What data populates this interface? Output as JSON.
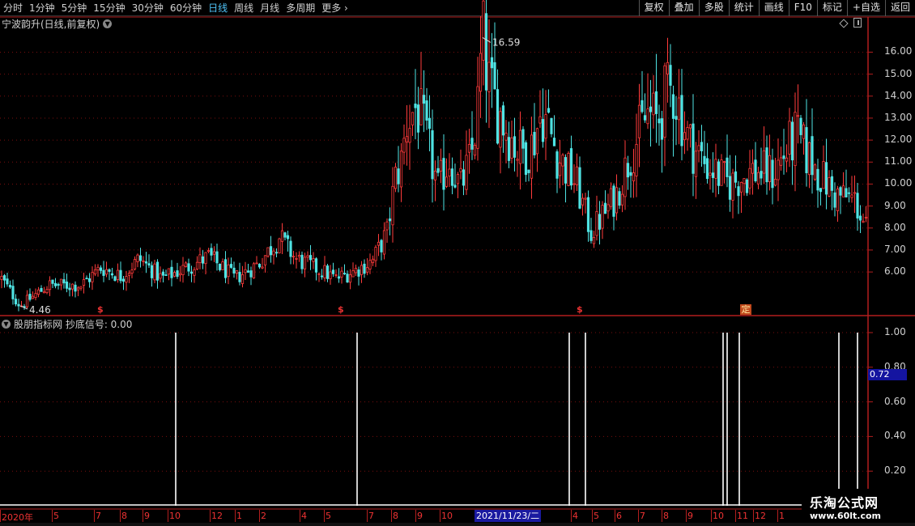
{
  "toolbar": {
    "period_tabs": [
      "分时",
      "1分钟",
      "5分钟",
      "15分钟",
      "30分钟",
      "60分钟",
      "日线",
      "周线",
      "月线",
      "多周期",
      "更多"
    ],
    "active_tab": "日线",
    "right_tools": [
      "复权",
      "叠加",
      "多股",
      "统计",
      "画线",
      "F10",
      "标记",
      "+自选",
      "返回"
    ]
  },
  "main_panel": {
    "title": "宁波韵升(日线,前复权)",
    "high_label": "16.59",
    "low_label": "4.46",
    "y_ticks": [
      "16.00",
      "15.00",
      "14.00",
      "13.00",
      "12.00",
      "11.00",
      "10.00",
      "9.00",
      "8.00",
      "7.00",
      "6.00"
    ],
    "signal_markers": [
      {
        "text": "$",
        "at_index": 110
      },
      {
        "text": "$",
        "at_index": 407
      },
      {
        "text": "$",
        "at_index": 702
      }
    ],
    "ding_marker": "定"
  },
  "indicator_panel": {
    "title": "股朋指标网 抄底信号: 0.00",
    "y_ticks": [
      "1.00",
      "0.80",
      "0.60",
      "0.40",
      "0.20"
    ],
    "current_value": "0.72"
  },
  "date_axis": {
    "labels": [
      "2020年",
      "5",
      "7",
      "8",
      "9",
      "10",
      "12",
      "1",
      "2",
      "4",
      "5",
      "7",
      "8",
      "9",
      "10",
      "4",
      "5",
      "6",
      "7",
      "8",
      "9",
      "10",
      "11",
      "12",
      "1"
    ],
    "cursor_date": "2021/11/23/二"
  },
  "chart_data": {
    "type": "candlestick",
    "price_range": [
      4.2,
      16.9
    ],
    "anchors": [
      [
        0,
        5.8
      ],
      [
        25,
        4.46
      ],
      [
        60,
        5.4
      ],
      [
        100,
        5.4
      ],
      [
        125,
        6.2
      ],
      [
        150,
        5.8
      ],
      [
        172,
        6.6
      ],
      [
        200,
        5.7
      ],
      [
        230,
        6.2
      ],
      [
        258,
        6.7
      ],
      [
        290,
        5.7
      ],
      [
        320,
        6.4
      ],
      [
        345,
        7.6
      ],
      [
        365,
        6.6
      ],
      [
        400,
        6.0
      ],
      [
        415,
        5.7
      ],
      [
        440,
        6.1
      ],
      [
        460,
        6.5
      ],
      [
        478,
        7.8
      ],
      [
        488,
        10.2
      ],
      [
        497,
        11.2
      ],
      [
        502,
        12.8
      ],
      [
        515,
        13.6
      ],
      [
        530,
        11.5
      ],
      [
        541,
        9.8
      ],
      [
        555,
        11.2
      ],
      [
        568,
        9.8
      ],
      [
        582,
        11.2
      ],
      [
        590,
        13.5
      ],
      [
        596,
        16.59
      ],
      [
        605,
        14.2
      ],
      [
        620,
        13.0
      ],
      [
        640,
        11.5
      ],
      [
        655,
        11.6
      ],
      [
        670,
        13.4
      ],
      [
        690,
        11.2
      ],
      [
        712,
        10.0
      ],
      [
        730,
        7.8
      ],
      [
        760,
        9.4
      ],
      [
        780,
        11.5
      ],
      [
        800,
        13.2
      ],
      [
        812,
        12.8
      ],
      [
        820,
        13.8
      ],
      [
        832,
        14.4
      ],
      [
        850,
        12.0
      ],
      [
        870,
        11.0
      ],
      [
        900,
        10.0
      ],
      [
        930,
        10.6
      ],
      [
        955,
        10.5
      ],
      [
        983,
        12.2
      ],
      [
        995,
        11.4
      ],
      [
        1010,
        10.6
      ],
      [
        1030,
        9.5
      ],
      [
        1055,
        9.3
      ],
      [
        1072,
        7.8
      ]
    ],
    "signals": [
      {
        "index": 217,
        "value": 1.0
      },
      {
        "index": 441,
        "value": 1.0
      },
      {
        "index": 703,
        "value": 1.0
      },
      {
        "index": 723,
        "value": 1.0
      },
      {
        "index": 893,
        "value": 1.0
      },
      {
        "index": 898,
        "value": 1.0
      },
      {
        "index": 913,
        "value": 1.0
      },
      {
        "index": 1036,
        "value": 1.0
      },
      {
        "index": 1059,
        "value": 1.0
      }
    ],
    "indicator_range": [
      0.0,
      1.0
    ],
    "colors": {
      "up": "#ff3b3b",
      "down": "#4fe3e3",
      "grid": "#7a0e0e",
      "axis": "#b21e1e",
      "signal": "#ffffff"
    }
  }
}
